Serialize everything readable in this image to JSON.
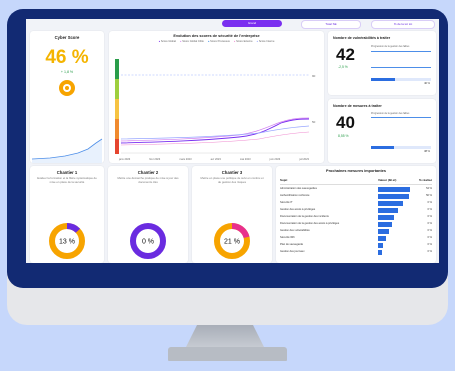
{
  "tabs": [
    "Grand",
    "Total SE",
    "% de la tot tot"
  ],
  "cyber": {
    "title": "Cyber Score",
    "score": "46 %",
    "delta": "+ 1,8 %"
  },
  "evolution": {
    "title": "Evolution des scores de sécurité de l'entreprise",
    "legend": [
      "Score Global",
      "Score Global Cible",
      "Score Processus",
      "Score Externe",
      "Score Interne"
    ],
    "y_ticks": [
      "90",
      "50"
    ],
    "x_ticks": [
      "janv 2023",
      "févr 2023",
      "mars 2023",
      "avr 2023",
      "mai 2023",
      "juin 2023",
      "juil 2023"
    ],
    "colors": {
      "global": "#7a2ff0",
      "cible": "#d27ff0",
      "process": "#3a8ee6",
      "externe": "#f08ad0",
      "interne": "#98a6ff"
    }
  },
  "vuln": {
    "title": "Nombre de vulnérabilités à traiter",
    "value": "42",
    "delta": "-2,5 %",
    "bar_label": "Progression de la gestion des failles",
    "pct": "40 %"
  },
  "actions": {
    "title": "Nombre de mesures à traiter",
    "value": "40",
    "delta": "8,55 %",
    "bar_label": "Progression de la gestion des failles",
    "pct": "38 %"
  },
  "chantiers": [
    {
      "title": "Chantier 1",
      "desc": "Evaluer la formation et la filière systématique de mise en place de la sécurité",
      "pct": "13 %",
      "fill": 0.13
    },
    {
      "title": "Chantier 2",
      "desc": "Mettre une démarche pratique de mise à jour des documents clés",
      "pct": "0 %",
      "fill": 0.0
    },
    {
      "title": "Chantier 3",
      "desc": "Mettre en place une politique de suivi en continu et de gestion des risques",
      "pct": "21 %",
      "fill": 0.21
    }
  ],
  "mesures": {
    "title": "Prochaines mesures importantes",
    "col_subject": "Sujet",
    "col_value": "Valeur (IB et)",
    "col_pct": "% réalisé",
    "rows": [
      {
        "label": "Administration des sauvegardes",
        "pct": "54 %",
        "val": 0.9
      },
      {
        "label": "Authentification renforcée",
        "pct": "50 %",
        "val": 0.85
      },
      {
        "label": "Sécurité IT",
        "pct": "0 %",
        "val": 0.7
      },
      {
        "label": "Gestion des accès à privilèges",
        "pct": "0 %",
        "val": 0.55
      },
      {
        "label": "Documentation de la gestion des incidents",
        "pct": "0 %",
        "val": 0.45
      },
      {
        "label": "Documentation de la gestion des accès à privilèges",
        "pct": "0 %",
        "val": 0.4
      },
      {
        "label": "Gestion des vulnérabilités",
        "pct": "0 %",
        "val": 0.3
      },
      {
        "label": "Sécurité Wifi",
        "pct": "0 %",
        "val": 0.22
      },
      {
        "label": "Plan de sauvegarde",
        "pct": "0 %",
        "val": 0.15
      },
      {
        "label": "Gestion des journaux",
        "pct": "0 %",
        "val": 0.1
      }
    ]
  }
}
